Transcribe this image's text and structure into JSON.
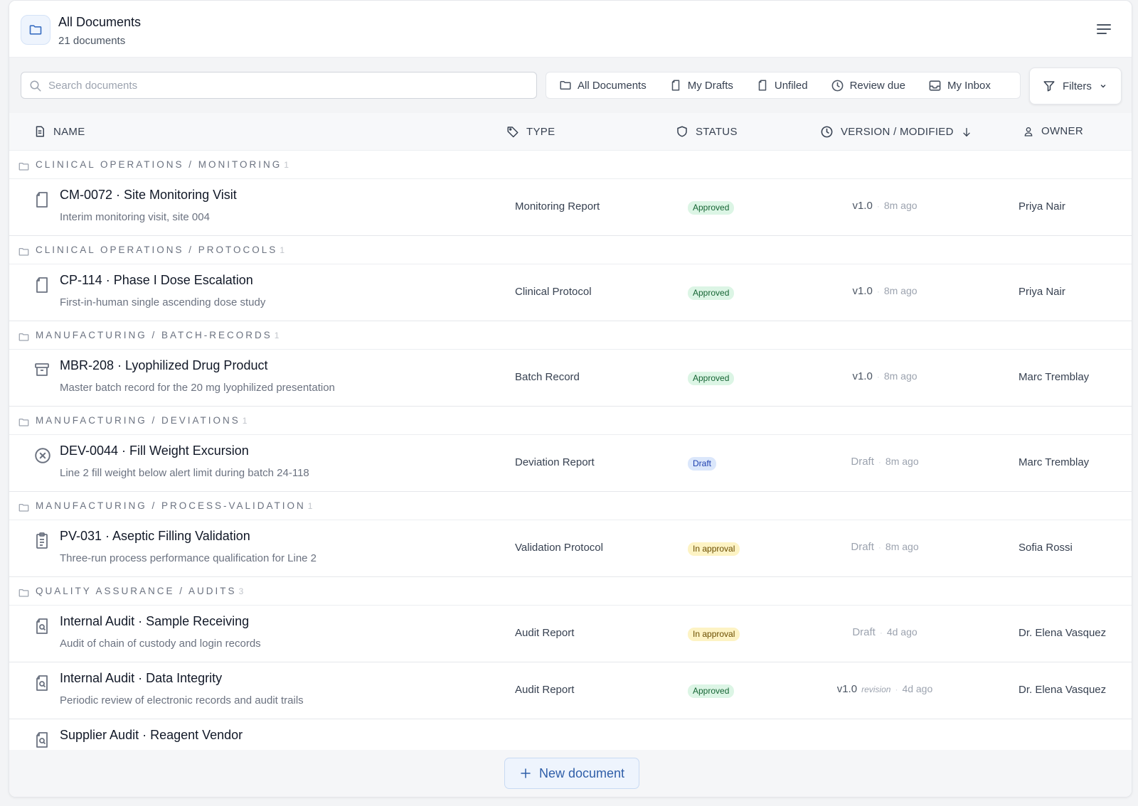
{
  "header": {
    "title": "All Documents",
    "subtitle": "21 documents",
    "icon": "folder-icon"
  },
  "search": {
    "placeholder": "Search documents",
    "value": ""
  },
  "views": [
    {
      "label": "All Documents",
      "icon": "folder-icon"
    },
    {
      "label": "My Drafts",
      "icon": "file-icon"
    },
    {
      "label": "Unfiled",
      "icon": "file-icon"
    },
    {
      "label": "Review due",
      "icon": "clock-icon"
    },
    {
      "label": "My Inbox",
      "icon": "inbox-icon"
    }
  ],
  "filters": {
    "label": "Filters"
  },
  "columns": {
    "name": "NAME",
    "type": "TYPE",
    "status": "STATUS",
    "version": "VERSION / MODIFIED",
    "owner": "OWNER"
  },
  "groups": [
    {
      "label": "CLINICAL OPERATIONS / MONITORING",
      "count": "1",
      "docs": [
        {
          "title": "CM-0072 · Site Monitoring Visit",
          "desc": "Interim monitoring visit, site 004",
          "type": "Monitoring Report",
          "status": "Approved",
          "version": "v1.0",
          "modified": "8m ago",
          "owner": "Priya Nair",
          "icon": "file-icon"
        }
      ]
    },
    {
      "label": "CLINICAL OPERATIONS / PROTOCOLS",
      "count": "1",
      "docs": [
        {
          "title": "CP-114 · Phase I Dose Escalation",
          "desc": "First-in-human single ascending dose study",
          "type": "Clinical Protocol",
          "status": "Approved",
          "version": "v1.0",
          "modified": "8m ago",
          "owner": "Priya Nair",
          "icon": "file-icon"
        }
      ]
    },
    {
      "label": "MANUFACTURING / BATCH-RECORDS",
      "count": "1",
      "docs": [
        {
          "title": "MBR-208 · Lyophilized Drug Product",
          "desc": "Master batch record for the 20 mg lyophilized presentation",
          "type": "Batch Record",
          "status": "Approved",
          "version": "v1.0",
          "modified": "8m ago",
          "owner": "Marc Tremblay",
          "icon": "archive-icon"
        }
      ]
    },
    {
      "label": "MANUFACTURING / DEVIATIONS",
      "count": "1",
      "docs": [
        {
          "title": "DEV-0044 · Fill Weight Excursion",
          "desc": "Line 2 fill weight below alert limit during batch 24-118",
          "type": "Deviation Report",
          "status": "Draft",
          "version": "Draft",
          "modified": "8m ago",
          "owner": "Marc Tremblay",
          "icon": "x-circle-icon"
        }
      ]
    },
    {
      "label": "MANUFACTURING / PROCESS-VALIDATION",
      "count": "1",
      "docs": [
        {
          "title": "PV-031 · Aseptic Filling Validation",
          "desc": "Three-run process performance qualification for Line 2",
          "type": "Validation Protocol",
          "status": "In approval",
          "version": "Draft",
          "modified": "8m ago",
          "owner": "Sofia Rossi",
          "icon": "clipboard-icon"
        }
      ]
    },
    {
      "label": "QUALITY ASSURANCE / AUDITS",
      "count": "3",
      "docs": [
        {
          "title": "Internal Audit · Sample Receiving",
          "desc": "Audit of chain of custody and login records",
          "type": "Audit Report",
          "status": "In approval",
          "version": "Draft",
          "modified": "4d ago",
          "owner": "Dr. Elena Vasquez",
          "icon": "file-search-icon"
        },
        {
          "title": "Internal Audit · Data Integrity",
          "desc": "Periodic review of electronic records and audit trails",
          "type": "Audit Report",
          "status": "Approved",
          "version": "v1.0",
          "revision": "revision",
          "modified": "4d ago",
          "owner": "Dr. Elena Vasquez",
          "icon": "file-search-icon"
        },
        {
          "title": "Supplier Audit · Reagent Vendor",
          "desc": "",
          "type": "",
          "status": "",
          "version": "",
          "modified": "",
          "owner": "",
          "icon": "file-search-icon"
        }
      ]
    }
  ],
  "footer": {
    "new_label": "New document"
  }
}
